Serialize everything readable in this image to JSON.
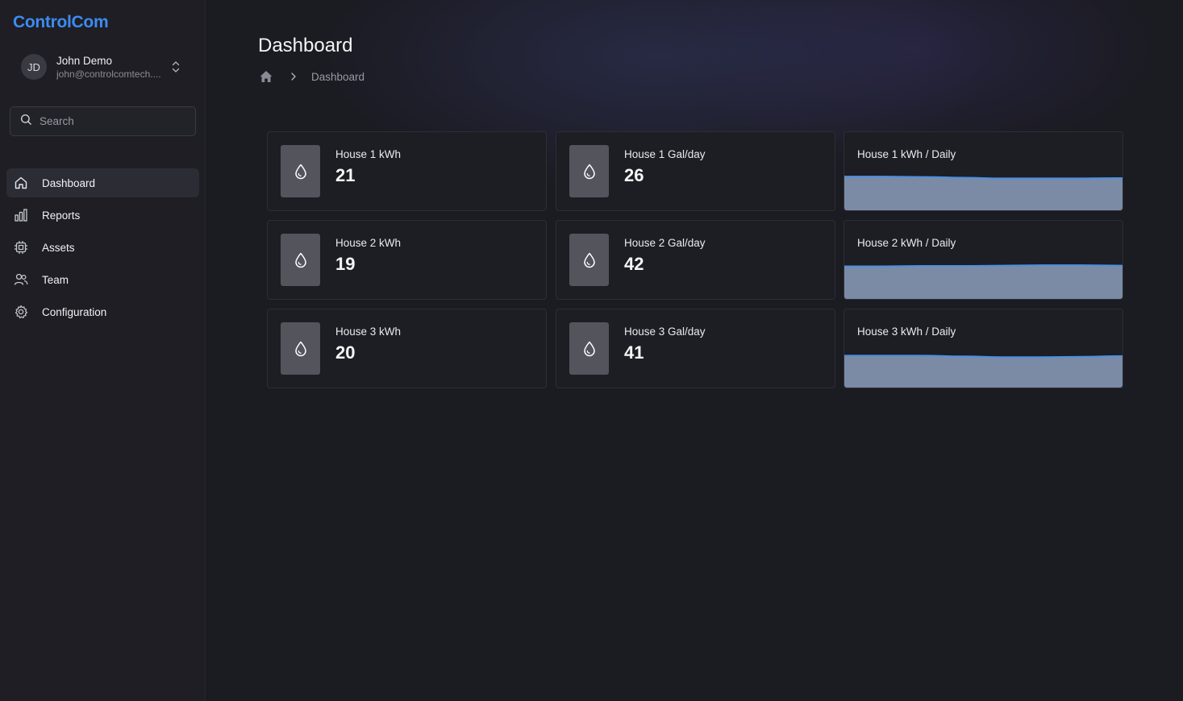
{
  "brand": "ControlCom",
  "user": {
    "initials": "JD",
    "name": "John Demo",
    "email": "john@controlcomtech...."
  },
  "search": {
    "placeholder": "Search"
  },
  "nav": [
    {
      "label": "Dashboard",
      "icon": "home-icon",
      "active": true
    },
    {
      "label": "Reports",
      "icon": "bar-chart-icon",
      "active": false
    },
    {
      "label": "Assets",
      "icon": "chip-icon",
      "active": false
    },
    {
      "label": "Team",
      "icon": "users-icon",
      "active": false
    },
    {
      "label": "Configuration",
      "icon": "gear-icon",
      "active": false
    }
  ],
  "page": {
    "title": "Dashboard",
    "breadcrumb": {
      "current": "Dashboard"
    }
  },
  "colors": {
    "accent": "#3d8bf0",
    "chart_fill": "#7b8ba6",
    "chart_line": "#4a90e2",
    "icon_box": "#54545d"
  },
  "stats": [
    {
      "label": "House 1 kWh",
      "value": "21",
      "icon": "water-drop-icon"
    },
    {
      "label": "House 1 Gal/day",
      "value": "26",
      "icon": "water-drop-icon"
    },
    {
      "label": "House 2 kWh",
      "value": "19",
      "icon": "water-drop-icon"
    },
    {
      "label": "House 2 Gal/day",
      "value": "42",
      "icon": "water-drop-icon"
    },
    {
      "label": "House 3 kWh",
      "value": "20",
      "icon": "water-drop-icon"
    },
    {
      "label": "House 3 Gal/day",
      "value": "41",
      "icon": "water-drop-icon"
    }
  ],
  "charts": [
    {
      "title": "House 1 kWh / Daily"
    },
    {
      "title": "House 2 kWh / Daily"
    },
    {
      "title": "House 3 kWh / Daily"
    }
  ],
  "chart_data": [
    {
      "type": "area",
      "title": "House 1 kWh / Daily",
      "values": [
        0.93,
        0.93,
        0.92,
        0.9,
        0.88,
        0.88,
        0.88,
        0.89
      ],
      "ylim": [
        0,
        1
      ]
    },
    {
      "type": "area",
      "title": "House 2 kWh / Daily",
      "values": [
        0.9,
        0.9,
        0.91,
        0.91,
        0.92,
        0.93,
        0.93,
        0.92
      ],
      "ylim": [
        0,
        1
      ]
    },
    {
      "type": "area",
      "title": "House 3 kWh / Daily",
      "values": [
        0.88,
        0.88,
        0.88,
        0.86,
        0.84,
        0.84,
        0.85,
        0.87
      ],
      "ylim": [
        0,
        1
      ]
    }
  ]
}
